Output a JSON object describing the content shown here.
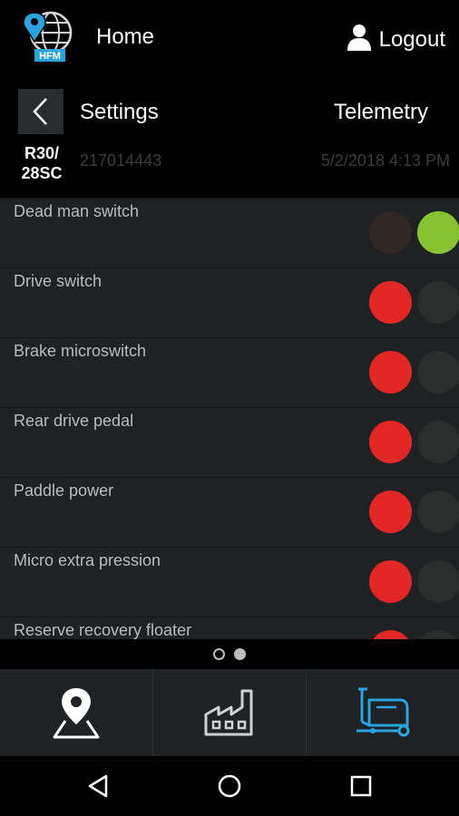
{
  "header": {
    "logo_text": "HFM",
    "home_label": "Home",
    "logout_label": "Logout"
  },
  "machine": {
    "settings_label": "Settings",
    "telemetry_label": "Telemetry",
    "model": "R30/ 28SC",
    "serial": "217014443",
    "datetime": "5/2/2018 4:13 PM"
  },
  "colors": {
    "red": "#e32727",
    "green": "#86c232",
    "off_red": "#312826",
    "off_dark": "#2b2e2c",
    "accent_blue": "#2aa3e0"
  },
  "signals": [
    {
      "label": "Dead man switch",
      "state": "green"
    },
    {
      "label": "Drive switch",
      "state": "red"
    },
    {
      "label": "Brake microswitch",
      "state": "red"
    },
    {
      "label": "Rear drive pedal",
      "state": "red"
    },
    {
      "label": "Paddle power",
      "state": "red"
    },
    {
      "label": "Micro extra pression",
      "state": "red"
    },
    {
      "label": "Reserve recovery floater",
      "state": "red"
    }
  ],
  "pager": {
    "pages": 2,
    "current": 2
  },
  "tabs": [
    {
      "icon": "map-pin-icon",
      "active": false
    },
    {
      "icon": "factory-icon",
      "active": false
    },
    {
      "icon": "scrubber-machine-icon",
      "active": true
    }
  ],
  "system_nav": [
    "back-nav-icon",
    "home-nav-icon",
    "recents-nav-icon"
  ]
}
